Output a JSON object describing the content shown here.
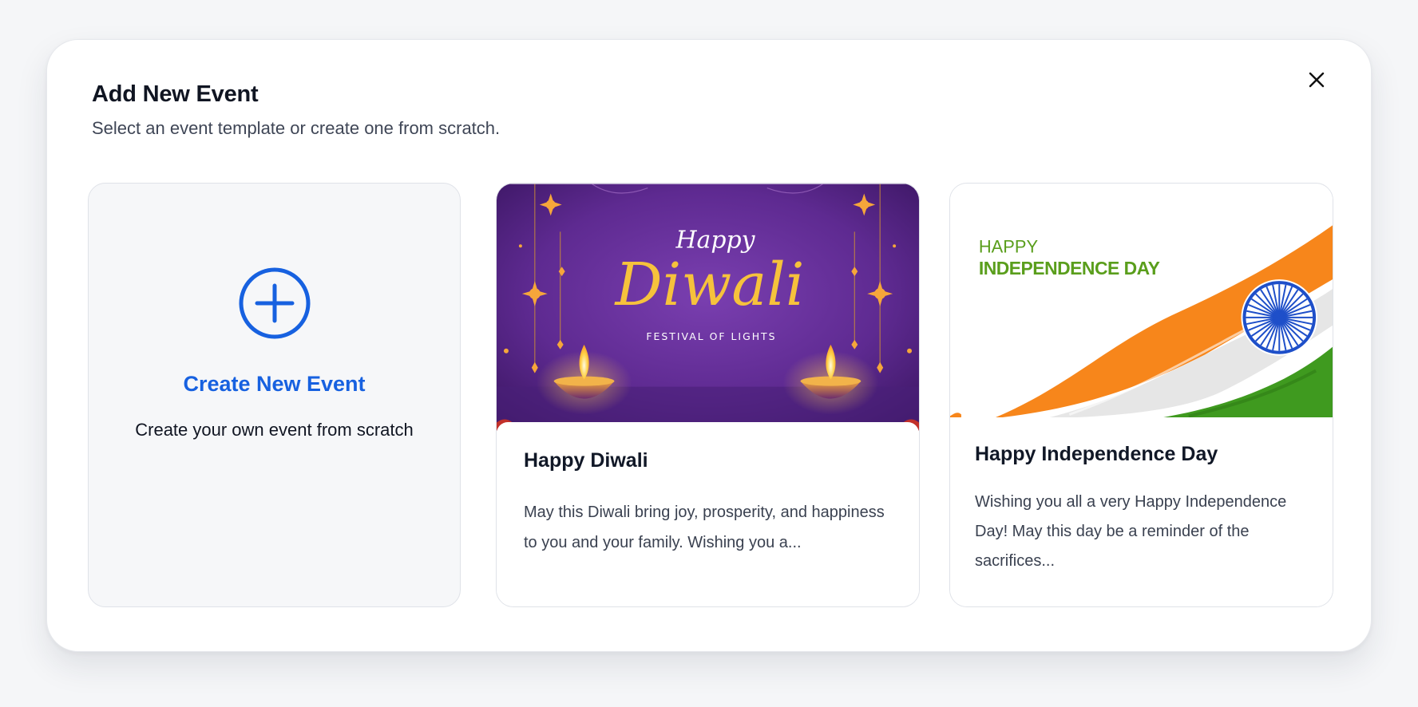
{
  "modal": {
    "title": "Add New Event",
    "subtitle": "Select an event template or create one from scratch.",
    "close_icon": "close-icon"
  },
  "create_card": {
    "icon": "plus-circle-icon",
    "title": "Create New Event",
    "description": "Create your own event from scratch",
    "accent_color": "#1761e0"
  },
  "templates": [
    {
      "title": "Happy Diwali",
      "description": "May this Diwali bring joy, prosperity, and happiness to you and your family. Wishing you a...",
      "image": {
        "heading_small": "Happy",
        "heading_large": "Diwali",
        "tagline": "FESTIVAL OF LIGHTS",
        "background_color": "#5e2a91",
        "text_color": "#f6c23c"
      }
    },
    {
      "title": "Happy Independence Day",
      "description": "Wishing you all a very Happy Independence Day! May this day be a reminder of the sacrifices...",
      "image": {
        "line1": "HAPPY",
        "line2": "INDEPENDENCE DAY",
        "text_color": "#5a9e1c",
        "saffron": "#f7861b",
        "white": "#e8e8e8",
        "green": "#3f9a1f",
        "chakra": "#1e4fc9"
      }
    }
  ]
}
